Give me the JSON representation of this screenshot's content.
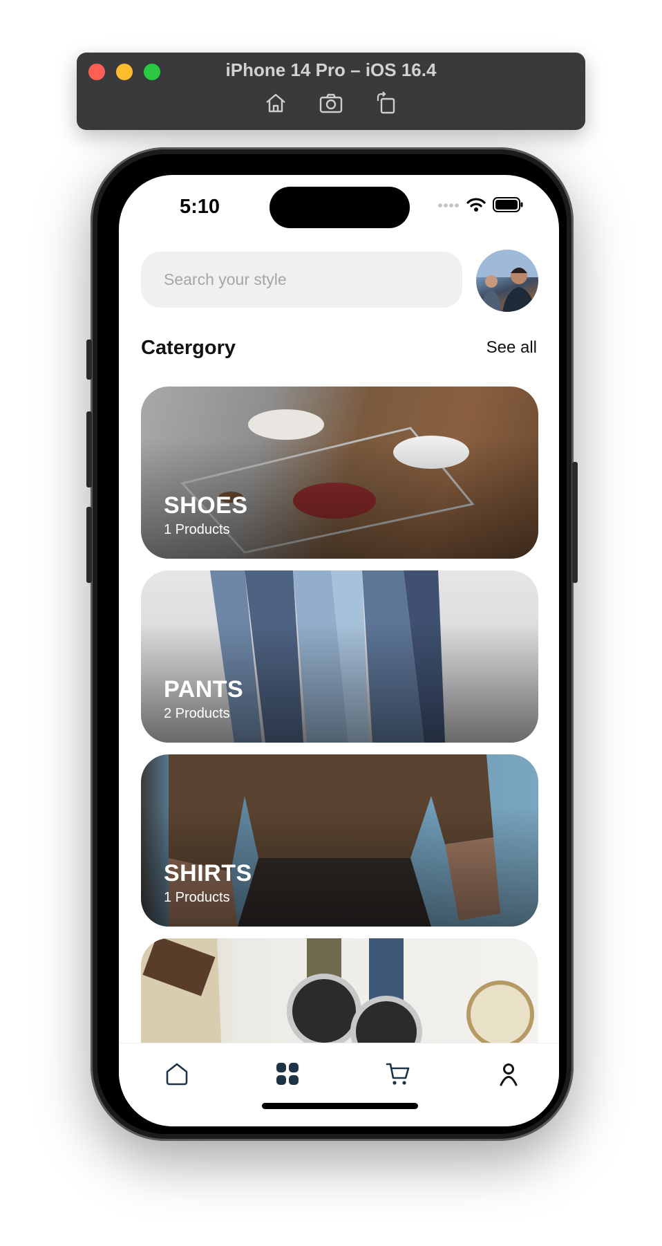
{
  "simulator": {
    "title": "iPhone 14 Pro – iOS 16.4",
    "icons": [
      "home-icon",
      "screenshot-icon",
      "rotate-icon"
    ]
  },
  "status_bar": {
    "time": "5:10",
    "icons": [
      "cellular-icon",
      "wifi-icon",
      "battery-icon"
    ]
  },
  "search": {
    "placeholder": "Search your style"
  },
  "section": {
    "title": "Catergory",
    "see_all": "See all"
  },
  "categories": [
    {
      "name": "SHOES",
      "count": "1 Products"
    },
    {
      "name": "PANTS",
      "count": "2 Products"
    },
    {
      "name": "SHIRTS",
      "count": "1 Products"
    },
    {
      "name": "",
      "count": ""
    }
  ],
  "tab_bar": {
    "items": [
      "home-icon",
      "categories-icon",
      "cart-icon",
      "profile-icon"
    ],
    "active_index": 1,
    "color": "#1f3346"
  }
}
